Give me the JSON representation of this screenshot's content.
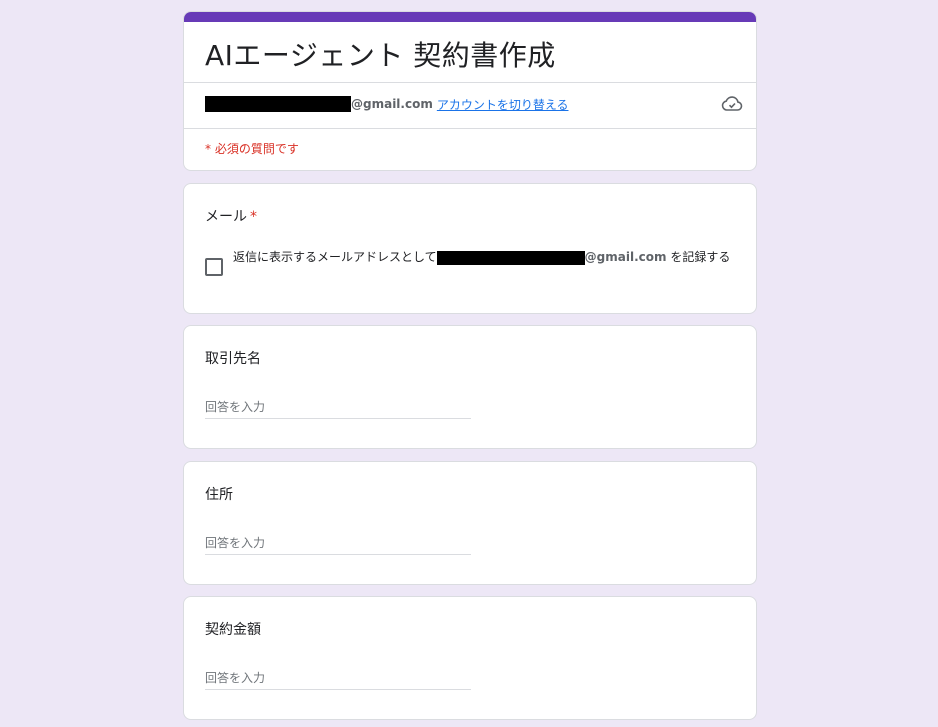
{
  "form": {
    "title": "AIエージェント 契約書作成",
    "account_email_suffix": "@gmail.com",
    "switch_account_label": "アカウントを切り替える",
    "required_note": "* 必須の質問です"
  },
  "questions": {
    "email": {
      "title": "メール",
      "required_mark": "*",
      "checkbox_label_prefix": "返信に表示するメールアドレスとして",
      "checkbox_email_suffix": "@gmail.com",
      "checkbox_label_suffix": " を記録する"
    },
    "client": {
      "title": "取引先名",
      "placeholder": "回答を入力"
    },
    "address": {
      "title": "住所",
      "placeholder": "回答を入力"
    },
    "amount": {
      "title": "契約金額",
      "placeholder": "回答を入力"
    }
  },
  "colors": {
    "accent": "#673ab7",
    "background": "#ede7f6",
    "required": "#d93025",
    "link": "#1a73e8"
  },
  "icons": {
    "save_status": "cloud-check-icon"
  }
}
